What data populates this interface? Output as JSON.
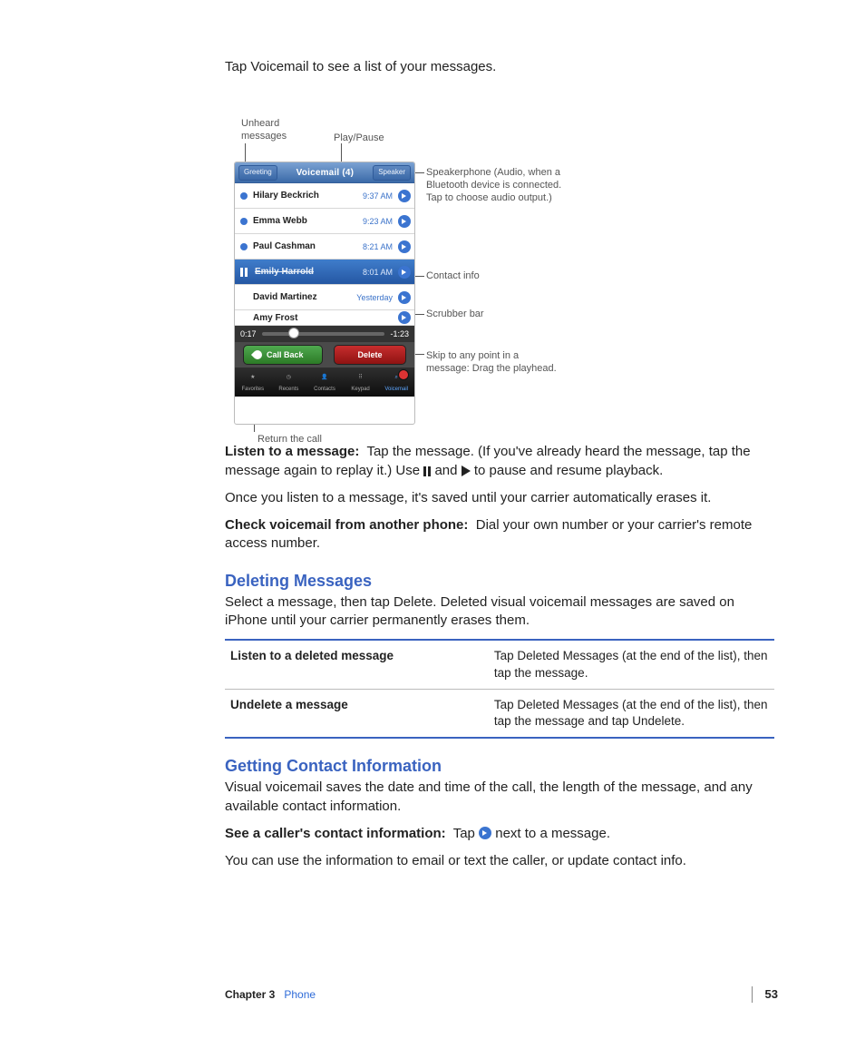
{
  "intro": "Tap Voicemail to see a list of your messages.",
  "annotations": {
    "unheard": "Unheard messages",
    "playpause": "Play/Pause",
    "speaker": "Speakerphone (Audio, when a Bluetooth device is connected. Tap to choose audio output.)",
    "contact": "Contact info",
    "scrubber": "Scrubber bar",
    "skip": "Skip to any point in a message: Drag the playhead.",
    "return": "Return the call"
  },
  "phone": {
    "greeting": "Greeting",
    "title": "Voicemail (4)",
    "speakerBtn": "Speaker",
    "rows": [
      {
        "name": "Hilary Beckrich",
        "time": "9:37 AM",
        "unheard": true
      },
      {
        "name": "Emma Webb",
        "time": "9:23 AM",
        "unheard": true
      },
      {
        "name": "Paul Cashman",
        "time": "8:21 AM",
        "unheard": true
      },
      {
        "name": "Emily Harrold",
        "time": "8:01 AM",
        "selected": true
      },
      {
        "name": "David Martinez",
        "time": "Yesterday"
      },
      {
        "name": "Amy Frost",
        "time": ""
      }
    ],
    "elapsed": "0:17",
    "remaining": "-1:23",
    "callback": "Call Back",
    "delete": "Delete",
    "tabs": [
      "Favorites",
      "Recents",
      "Contacts",
      "Keypad",
      "Voicemail"
    ]
  },
  "body": {
    "listen_label": "Listen to a message:",
    "listen_a": "Tap the message. (If you've already heard the message, tap the message again to replay it.) Use",
    "listen_b": "and",
    "listen_c": "to pause and resume playback.",
    "saved": "Once you listen to a message, it's saved until your carrier automatically erases it.",
    "check_label": "Check voicemail from another phone:",
    "check_text": "Dial your own number or your carrier's remote access number."
  },
  "deleting": {
    "heading": "Deleting Messages",
    "para": "Select a message, then tap Delete. Deleted visual voicemail messages are saved on iPhone until your carrier permanently erases them.",
    "rows": [
      {
        "l": "Listen to a deleted message",
        "r": "Tap Deleted Messages (at the end of the list), then tap the message."
      },
      {
        "l": "Undelete a message",
        "r": "Tap Deleted Messages (at the end of the list), then tap the message and tap Undelete."
      }
    ]
  },
  "contact": {
    "heading": "Getting Contact Information",
    "para": "Visual voicemail saves the date and time of the call, the length of the message, and any available contact information.",
    "see_label": "See a caller's contact information:",
    "see_a": "Tap",
    "see_b": "next to a message.",
    "after": "You can use the information to email or text the caller, or update contact info."
  },
  "footer": {
    "chapter": "Chapter 3",
    "section": "Phone",
    "page": "53"
  }
}
